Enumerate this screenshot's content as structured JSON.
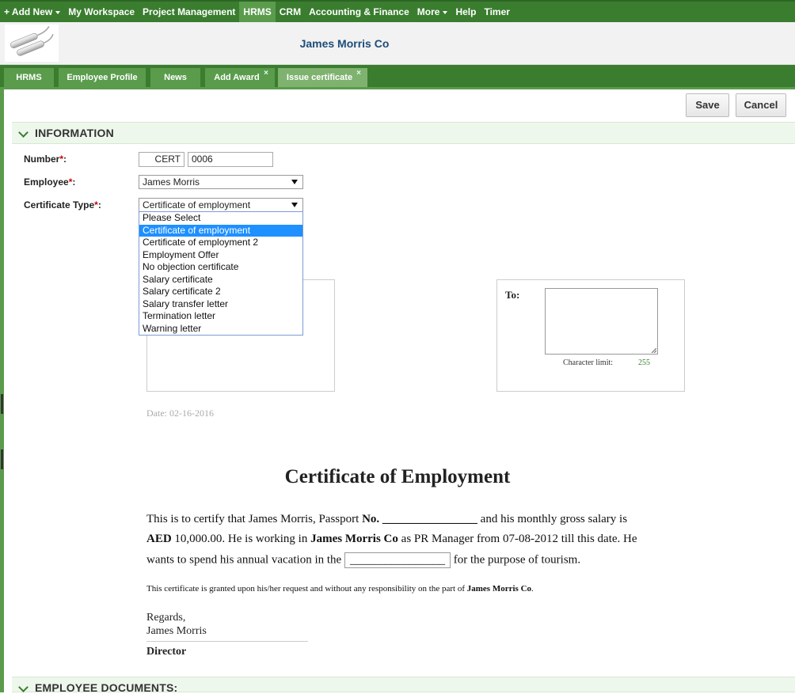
{
  "topnav": {
    "items": [
      {
        "label": "+ Add New",
        "caret": true
      },
      {
        "label": "My Workspace"
      },
      {
        "label": "Project Management"
      },
      {
        "label": "HRMS",
        "active": true
      },
      {
        "label": "CRM"
      },
      {
        "label": "Accounting & Finance"
      },
      {
        "label": "More",
        "caret": true
      },
      {
        "label": "Help"
      },
      {
        "label": "Timer"
      }
    ]
  },
  "header": {
    "company": "James Morris Co"
  },
  "tabs": [
    {
      "label": "HRMS"
    },
    {
      "label": "Employee Profile"
    },
    {
      "label": "News"
    },
    {
      "label": "Add Award",
      "closable": "×"
    },
    {
      "label": "Issue certificate",
      "closable": "×"
    }
  ],
  "actions": {
    "save": "Save",
    "cancel": "Cancel"
  },
  "information": {
    "title": "INFORMATION",
    "number_label": "Number",
    "number_prefix": "CERT",
    "number_value": "0006",
    "employee_label": "Employee",
    "employee_value": "James Morris",
    "type_label": "Certificate Type",
    "type_value": "Certificate of employment",
    "required_mark": "*",
    "colon": ":"
  },
  "dropdown_options": [
    "Please Select",
    "Certificate of employment",
    "Certificate of employment 2",
    "Employment Offer",
    "No objection certificate",
    "Salary certificate",
    "Salary certificate 2",
    "Salary transfer letter",
    "Termination letter",
    "Warning letter"
  ],
  "dropdown_selected_index": 1,
  "to_box": {
    "label": "To:",
    "char_limit_label": "Character limit:",
    "char_limit_value": "255"
  },
  "date_text": "Date: 02-16-2016",
  "certificate": {
    "title": "Certificate of Employment",
    "line1_a": "This is to certify that  James Morris, Passport ",
    "line1_bold": "No.",
    "line1_blank": "________________",
    "line1_b": " and his monthly gross salary is",
    "line2_bold": "AED",
    "line2_a": " 10,000.00. He is working in ",
    "line2_company": "James Morris Co",
    "line2_b": " as PR Manager from 07-08-2012 till this date. He",
    "line3_a": "wants to spend his annual vacation in the ",
    "line3_blank": "________________",
    "line3_b": " for the purpose of tourism.",
    "small_a": "This certificate is granted upon his/her request and without any responsibility on the part of ",
    "small_company": "James Morris Co",
    "small_end": ".",
    "regards": "Regards,",
    "signer": "James Morris",
    "signer_title": "Director"
  },
  "documents": {
    "title": "EMPLOYEE DOCUMENTS:"
  },
  "colors": {
    "nav_green": "#3a7d2f",
    "tab_green": "#5a9c4c",
    "accent_blue": "#1d4d79",
    "select_blue": "#1e90ff"
  }
}
